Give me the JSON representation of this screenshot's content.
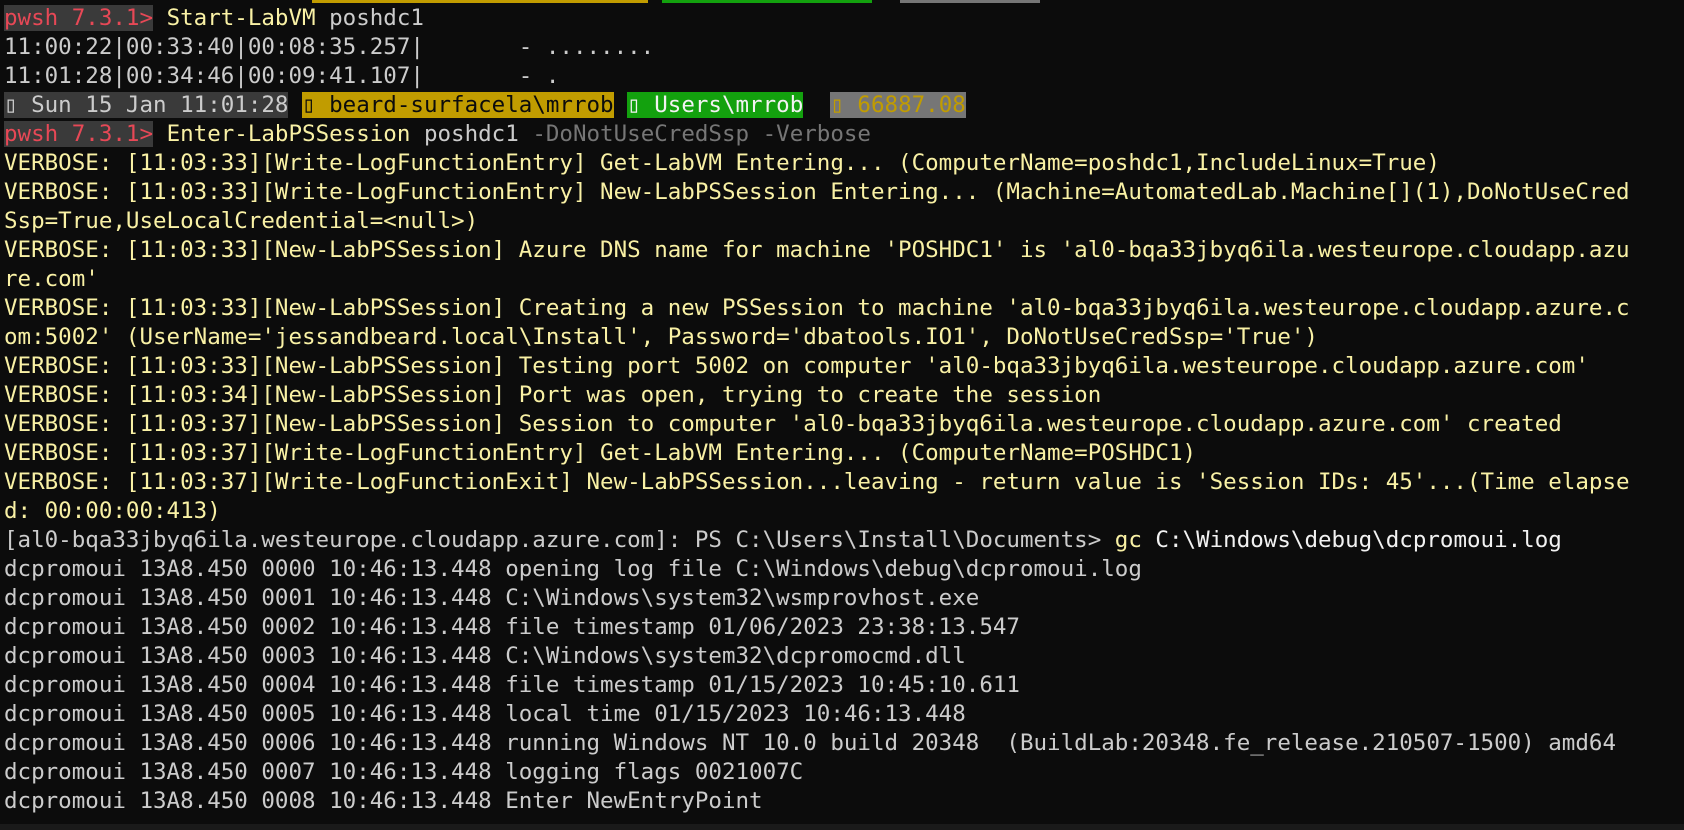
{
  "top_bar_colors": [
    "#c19c00",
    "#13a10e",
    "#767676"
  ],
  "prompt1": {
    "prefix": "pwsh 7.3.1>",
    "command": "Start-LabVM",
    "arg": "poshdc1"
  },
  "progress_lines": [
    "11:00:22|00:33:40|00:08:35.257|       - ........",
    "11:01:28|00:34:46|00:09:41.107|       - ."
  ],
  "status_bar": {
    "date": "▯ Sun 15 Jan 11:01:28",
    "user": "▯ beard-surfacela\\mrrob",
    "path": "▯ Users\\mrrob",
    "number": "▯ 66887.08"
  },
  "prompt2": {
    "prefix": "pwsh 7.3.1>",
    "command": "Enter-LabPSSession",
    "arg": "poshdc1",
    "params": "-DoNotUseCredSsp -Verbose"
  },
  "verbose_lines": [
    "VERBOSE: [11:03:33][Write-LogFunctionEntry] Get-LabVM Entering... (ComputerName=poshdc1,IncludeLinux=True)",
    "VERBOSE: [11:03:33][Write-LogFunctionEntry] New-LabPSSession Entering... (Machine=AutomatedLab.Machine[](1),DoNotUseCred",
    "Ssp=True,UseLocalCredential=<null>)",
    "VERBOSE: [11:03:33][New-LabPSSession] Azure DNS name for machine 'POSHDC1' is 'al0-bqa33jbyq6ila.westeurope.cloudapp.azu",
    "re.com'",
    "VERBOSE: [11:03:33][New-LabPSSession] Creating a new PSSession to machine 'al0-bqa33jbyq6ila.westeurope.cloudapp.azure.c",
    "om:5002' (UserName='jessandbeard.local\\Install', Password='dbatools.IO1', DoNotUseCredSsp='True')",
    "VERBOSE: [11:03:33][New-LabPSSession] Testing port 5002 on computer 'al0-bqa33jbyq6ila.westeurope.cloudapp.azure.com'",
    "VERBOSE: [11:03:34][New-LabPSSession] Port was open, trying to create the session",
    "VERBOSE: [11:03:37][New-LabPSSession] Session to computer 'al0-bqa33jbyq6ila.westeurope.cloudapp.azure.com' created",
    "VERBOSE: [11:03:37][Write-LogFunctionEntry] Get-LabVM Entering... (ComputerName=POSHDC1)",
    "VERBOSE: [11:03:37][Write-LogFunctionExit] New-LabPSSession...leaving - return value is 'Session IDs: 45'...(Time elapse",
    "d: 00:00:00:413)"
  ],
  "remote_prompt": {
    "prefix": "[al0-bqa33jbyq6ila.westeurope.cloudapp.azure.com]: PS C:\\Users\\Install\\Documents> ",
    "command": "gc",
    "arg": " C:\\Windows\\debug\\dcpromoui.log"
  },
  "log_lines": [
    "dcpromoui 13A8.450 0000 10:46:13.448 opening log file C:\\Windows\\debug\\dcpromoui.log",
    "dcpromoui 13A8.450 0001 10:46:13.448 C:\\Windows\\system32\\wsmprovhost.exe",
    "dcpromoui 13A8.450 0002 10:46:13.448 file timestamp 01/06/2023 23:38:13.547",
    "dcpromoui 13A8.450 0003 10:46:13.448 C:\\Windows\\system32\\dcpromocmd.dll",
    "dcpromoui 13A8.450 0004 10:46:13.448 file timestamp 01/15/2023 10:45:10.611",
    "dcpromoui 13A8.450 0005 10:46:13.448 local time 01/15/2023 10:46:13.448",
    "dcpromoui 13A8.450 0006 10:46:13.448 running Windows NT 10.0 build 20348  (BuildLab:20348.fe_release.210507-1500) amd64",
    "dcpromoui 13A8.450 0007 10:46:13.448 logging flags 0021007C",
    "dcpromoui 13A8.450 0008 10:46:13.448 Enter NewEntryPoint"
  ]
}
